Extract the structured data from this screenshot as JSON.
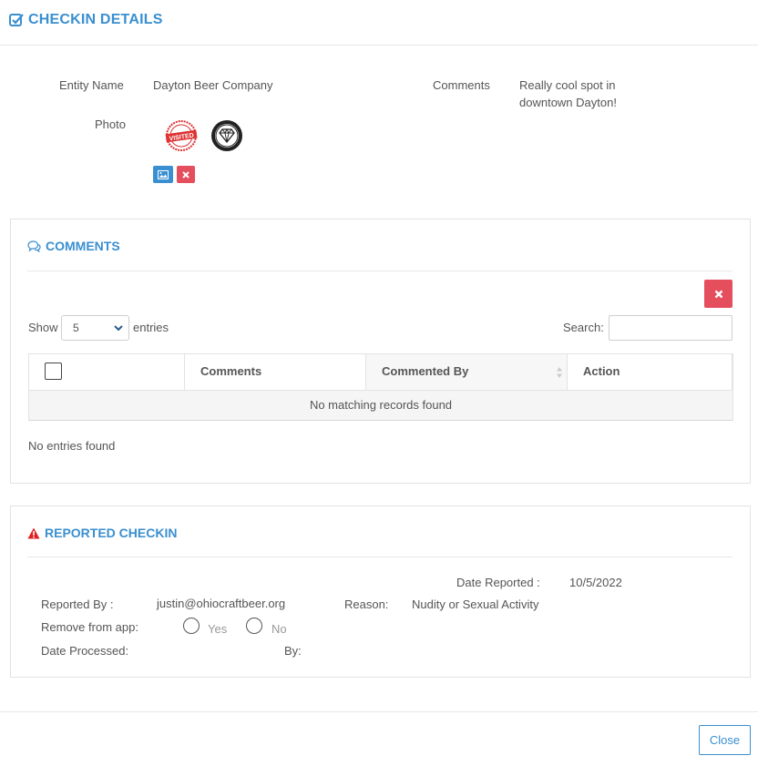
{
  "header": {
    "title": "CHECKIN DETAILS"
  },
  "details": {
    "entity_label": "Entity Name",
    "entity_value": "Dayton Beer Company",
    "photo_label": "Photo",
    "comments_label": "Comments",
    "comments_line1": "Really cool spot in",
    "comments_line2": "downtown Dayton!",
    "stamp_text": "VISITED"
  },
  "comments_panel": {
    "title": "COMMENTS",
    "show_label": "Show",
    "page_size": "5",
    "entries_label": "entries",
    "search_label": "Search:",
    "search_value": "",
    "columns": [
      "Comments",
      "Commented By",
      "Action"
    ],
    "empty_message": "No matching records found",
    "info": "No entries found"
  },
  "report_panel": {
    "title": "REPORTED CHECKIN",
    "date_reported_label": "Date Reported :",
    "date_reported_value": "10/5/2022",
    "reported_by_label": "Reported By :",
    "reported_by_value": "justin@ohiocraftbeer.org",
    "reason_label": "Reason:",
    "reason_value": "Nudity or Sexual Activity",
    "remove_label": "Remove from app:",
    "yes_label": "Yes",
    "no_label": "No",
    "date_processed_label": "Date Processed:",
    "by_label": "By:"
  },
  "footer": {
    "close_label": "Close"
  },
  "colors": {
    "accent": "#3a8fd0",
    "danger": "#e54e5d",
    "warning": "#e02020"
  }
}
